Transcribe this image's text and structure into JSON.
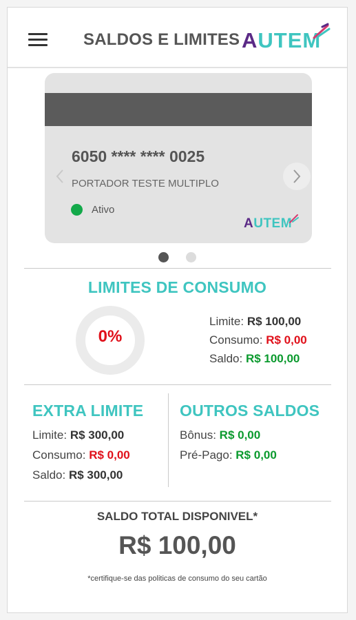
{
  "header": {
    "title": "SALDOS E LIMITES",
    "logo_first": "A",
    "logo_rest": "UTEM"
  },
  "card": {
    "number": "6050 **** **** 0025",
    "holder": "PORTADOR TESTE MULTIPLO",
    "status": "Ativo",
    "status_color": "#13a94a",
    "logo_first": "A",
    "logo_rest": "UTEM",
    "prev_icon": "chevron-left-icon",
    "next_icon": "chevron-right-icon"
  },
  "carousel": {
    "pages": 2,
    "active_index": 0
  },
  "consumo": {
    "title": "LIMITES DE CONSUMO",
    "percent_label": "0%",
    "percent_value": 0,
    "limite_label": "Limite:",
    "limite_value": "R$ 100,00",
    "consumo_label": "Consumo:",
    "consumo_value": "R$ 0,00",
    "saldo_label": "Saldo:",
    "saldo_value": "R$ 100,00"
  },
  "extra": {
    "title": "EXTRA LIMITE",
    "limite_label": "Limite:",
    "limite_value": "R$ 300,00",
    "consumo_label": "Consumo:",
    "consumo_value": "R$ 0,00",
    "saldo_label": "Saldo:",
    "saldo_value": "R$ 300,00"
  },
  "outros": {
    "title": "OUTROS SALDOS",
    "bonus_label": "Bônus:",
    "bonus_value": "R$ 0,00",
    "prepago_label": "Pré-Pago:",
    "prepago_value": "R$ 0,00"
  },
  "total": {
    "label": "SALDO TOTAL DISPONIVEL*",
    "value": "R$ 100,00",
    "footnote": "*certifique-se das politicas de consumo do seu cartão"
  },
  "colors": {
    "accent": "#3fc5c0",
    "brand_purple": "#5b2a86",
    "negative": "#e0101a",
    "positive": "#0b9a2e"
  }
}
